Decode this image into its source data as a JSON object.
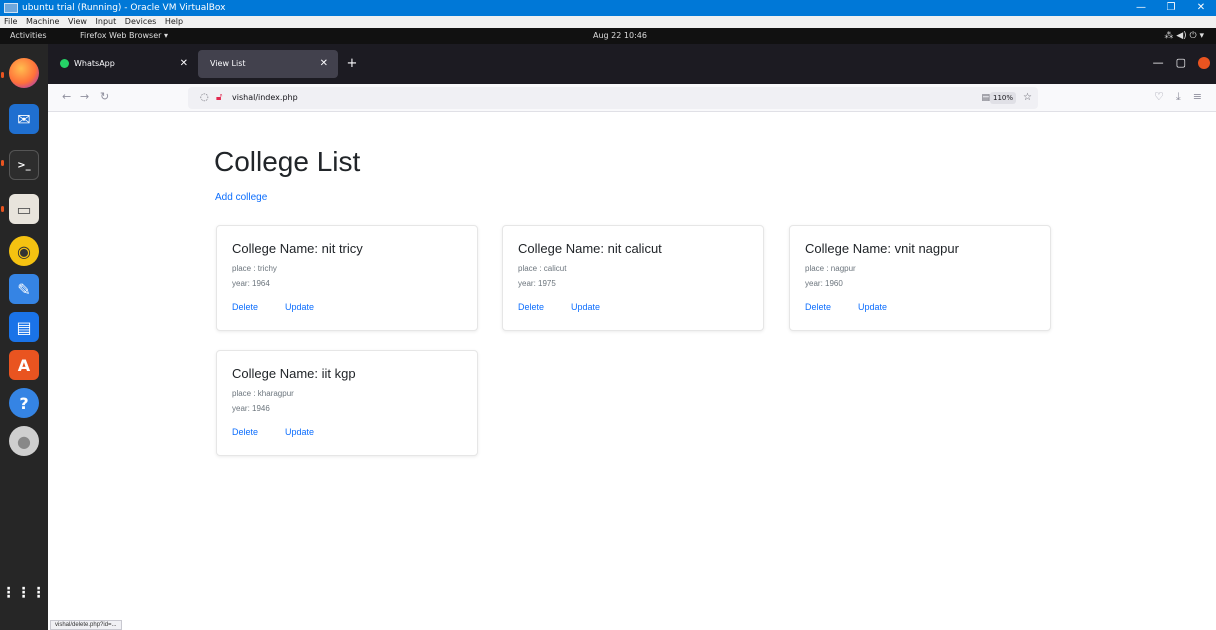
{
  "vbox": {
    "title": "ubuntu trial (Running) - Oracle VM VirtualBox",
    "menu": [
      "File",
      "Machine",
      "View",
      "Input",
      "Devices",
      "Help"
    ]
  },
  "gnome": {
    "activities": "Activities",
    "app_menu": "Firefox Web Browser ▾",
    "clock": "Aug 22 10:46",
    "tray": "⁂ ◀) ⏻ ▾"
  },
  "dock": {
    "icons": [
      "firefox-icon",
      "thunderbird-icon",
      "terminal-icon",
      "files-icon",
      "rhythmbox-icon",
      "text-editor-icon",
      "writer-icon",
      "software-icon",
      "help-icon",
      "disc-icon",
      "show-apps-icon"
    ]
  },
  "browser": {
    "tabs": [
      {
        "label": "WhatsApp"
      },
      {
        "label": "View List"
      }
    ],
    "url": "vishal/index.php",
    "zoom": "110%"
  },
  "page": {
    "title": "College List",
    "add_link": "Add college",
    "colleges": [
      {
        "name": "College Name: nit tricy",
        "place": "place : trichy",
        "year": "year: 1964",
        "delete": "Delete",
        "update": "Update"
      },
      {
        "name": "College Name: nit calicut",
        "place": "place : calicut",
        "year": "year: 1975",
        "delete": "Delete",
        "update": "Update"
      },
      {
        "name": "College Name: vnit nagpur",
        "place": "place : nagpur",
        "year": "year: 1960",
        "delete": "Delete",
        "update": "Update"
      },
      {
        "name": "College Name: iit kgp",
        "place": "place : kharagpur",
        "year": "year: 1946",
        "delete": "Delete",
        "update": "Update"
      }
    ]
  },
  "status_url": "vishal/delete.php?id=..."
}
